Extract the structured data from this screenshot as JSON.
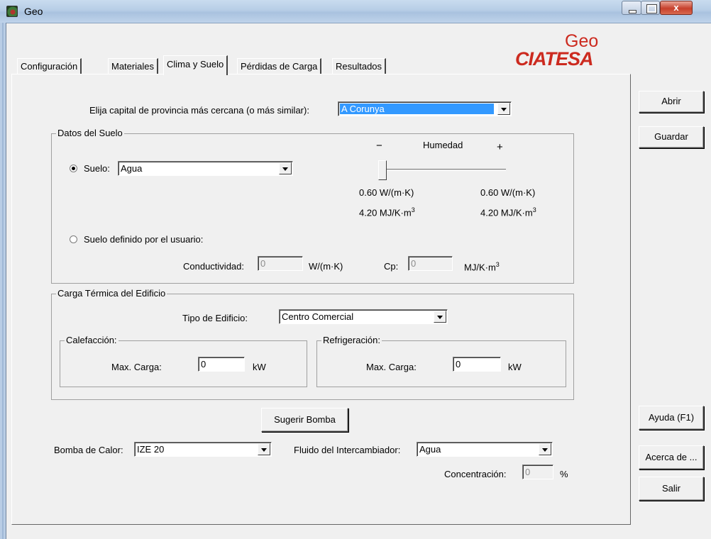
{
  "window": {
    "title": "Geo",
    "close_glyph": "x"
  },
  "logo": {
    "top": "Geo",
    "bottom": "CIATESA"
  },
  "tabs": [
    {
      "label": "Configuración",
      "active": false
    },
    {
      "label": "Materiales",
      "active": false
    },
    {
      "label": "Clima y Suelo",
      "active": true
    },
    {
      "label": "Pérdidas de Carga",
      "active": false
    },
    {
      "label": "Resultados",
      "active": false
    }
  ],
  "province": {
    "label": "Elija capital de provincia más cercana (o más similar):",
    "value": "A Corunya"
  },
  "soil": {
    "group_title": "Datos del Suelo",
    "radio_label": "Suelo:",
    "value": "Agua",
    "humidity_label": "Humedad",
    "minus": "−",
    "plus": "+",
    "humidity_level": 0,
    "left_conductivity": "0.60  W/(m·K)",
    "right_conductivity": "0.60  W/(m·K)",
    "left_cp_num": "4.20  MJ/K·m",
    "right_cp_num": "4.20  MJ/K·m",
    "cube": "3",
    "user_radio_label": "Suelo definido por el usuario:",
    "conductivity_label": "Conductividad:",
    "conductivity_value": "0",
    "conductivity_unit": "W/(m·K)",
    "cp_label": "Cp:",
    "cp_value": "0",
    "cp_unit": "MJ/K·m"
  },
  "load": {
    "group_title": "Carga Térmica del Edificio",
    "building_label": "Tipo de Edificio:",
    "building_value": "Centro Comercial",
    "heating_title": "Calefacción:",
    "heating_label": "Max. Carga:",
    "heating_value": "0",
    "heating_unit": "kW",
    "cooling_title": "Refrigeración:",
    "cooling_label": "Max. Carga:",
    "cooling_value": "0",
    "cooling_unit": "kW"
  },
  "suggest_button": "Sugerir Bomba",
  "pump": {
    "label": "Bomba de Calor:",
    "value": "IZE 20"
  },
  "fluid": {
    "label": "Fluido del Intercambiador:",
    "value": "Agua"
  },
  "concentration": {
    "label": "Concentración:",
    "value": "0",
    "unit": "%"
  },
  "side_buttons": {
    "open": "Abrir",
    "save": "Guardar",
    "help": "Ayuda (F1)",
    "about": "Acerca de ...",
    "exit": "Salir"
  }
}
